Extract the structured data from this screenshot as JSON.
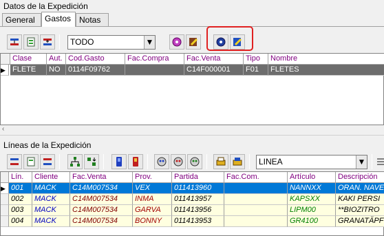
{
  "expedition": {
    "title": "Datos de la Expedición"
  },
  "tabs": [
    {
      "label": "General"
    },
    {
      "label": "Gastos"
    },
    {
      "label": "Notas"
    }
  ],
  "filter": {
    "value": "TODO"
  },
  "gastos": {
    "headers": [
      "Clase",
      "Aut.",
      "Cod.Gasto",
      "Fac.Compra",
      "Fac.Venta",
      "Tipo",
      "Nombre"
    ],
    "rows": [
      {
        "clase": "FLETE",
        "aut": "NO",
        "cod": "0114F09762",
        "fac_compra": "",
        "fac_venta": "C14F000001",
        "tipo": "F01",
        "nombre": "FLETES"
      }
    ]
  },
  "lineas": {
    "title": "Líneas de la Expedición",
    "combo": "LINEA",
    "headers": [
      "Lín.",
      "Cliente",
      "Fac.Venta",
      "Prov.",
      "Partida",
      "Fac.Com.",
      "Artículo",
      "Descripción"
    ],
    "rows": [
      {
        "lin": "001",
        "cliente": "MACK",
        "fac": "C14M007534",
        "prov": "VEX",
        "partida": "011413960",
        "faccom": "",
        "art": "NANNXX",
        "desc": "ORAN. NAVE"
      },
      {
        "lin": "002",
        "cliente": "MACK",
        "fac": "C14M007534",
        "prov": "INMA",
        "partida": "011413957",
        "faccom": "",
        "art": "KAPSXX",
        "desc": "KAKI PERSI"
      },
      {
        "lin": "003",
        "cliente": "MACK",
        "fac": "C14M007534",
        "prov": "GARVA",
        "partida": "011413956",
        "faccom": "",
        "art": "LIPM00",
        "desc": "**BIOZITRO"
      },
      {
        "lin": "004",
        "cliente": "MACK",
        "fac": "C14M007534",
        "prov": "BONNY",
        "partida": "011413953",
        "faccom": "",
        "art": "GR4100",
        "desc": "GRANATÄPF"
      }
    ]
  },
  "colors": {
    "header_text": "#800080",
    "selected_row": "#0078d7",
    "client_text": "#0000c0",
    "fac_text": "#800000",
    "prov_text": "#a00000",
    "art_text": "#008000",
    "row_bg": "#ffffe0",
    "highlight": "#e02020"
  }
}
